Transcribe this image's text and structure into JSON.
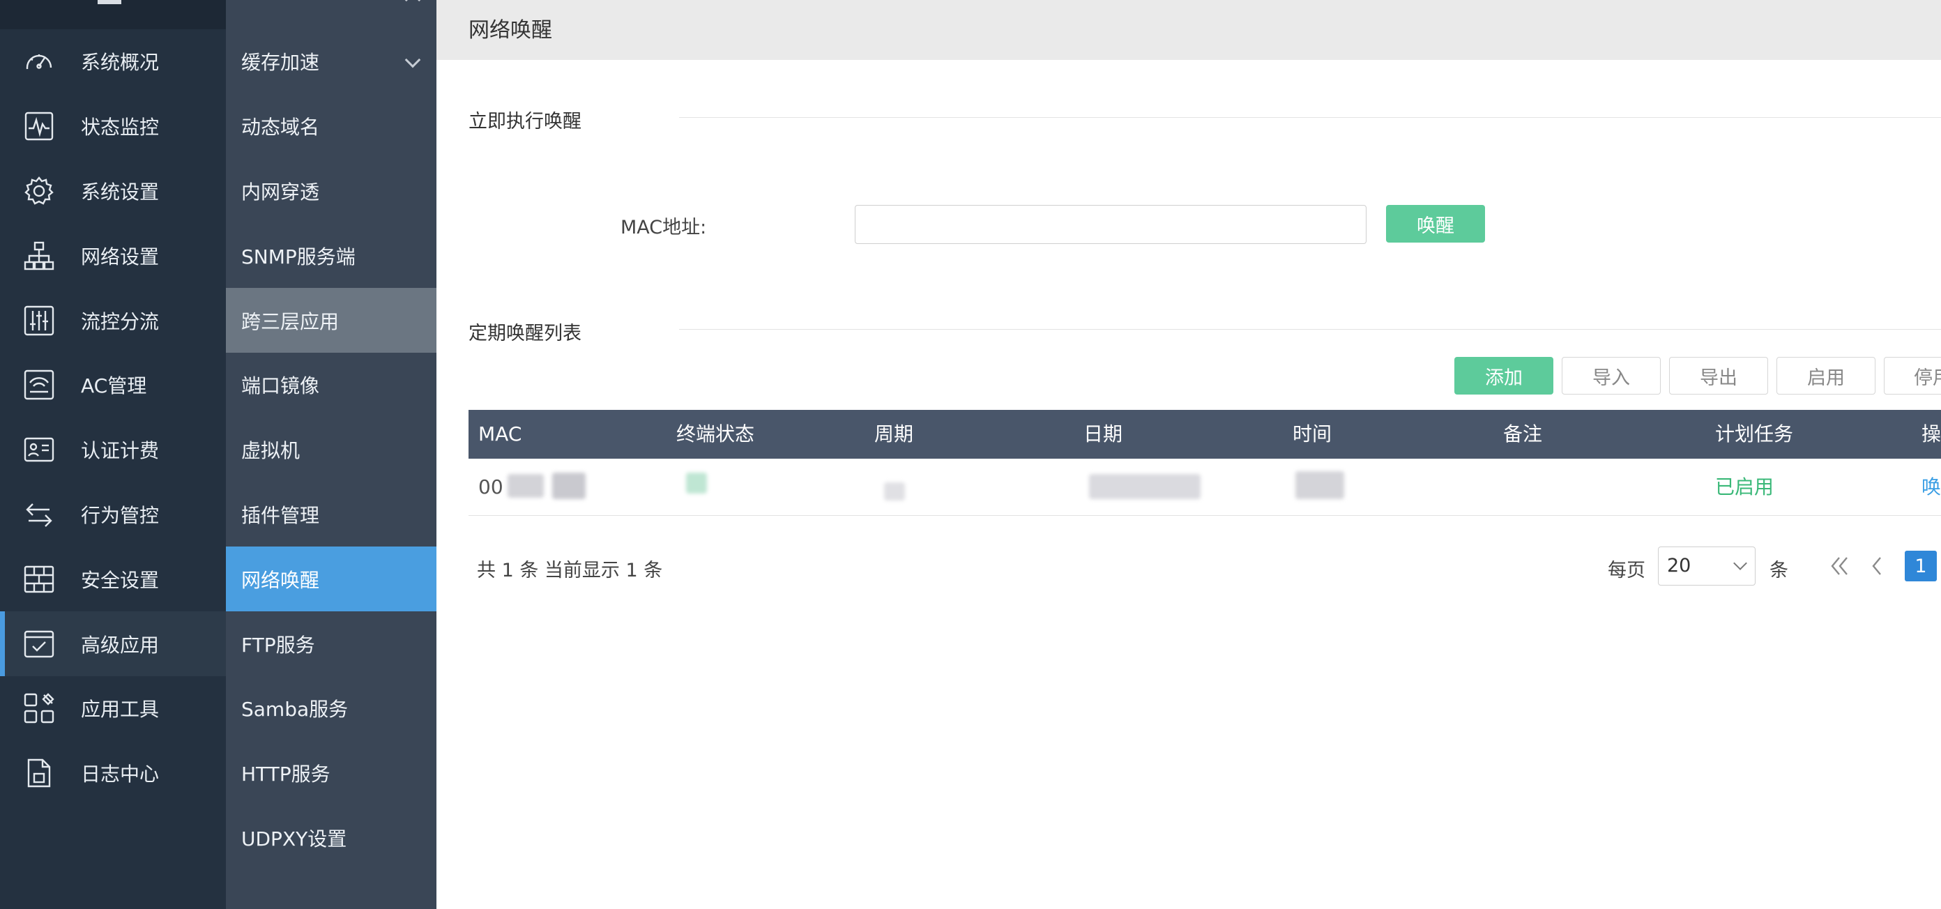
{
  "sidebar": {
    "items": [
      {
        "label": "系统概况",
        "icon": "dashboard-icon"
      },
      {
        "label": "状态监控",
        "icon": "pulse-monitor-icon"
      },
      {
        "label": "系统设置",
        "icon": "gear-icon"
      },
      {
        "label": "网络设置",
        "icon": "network-topology-icon"
      },
      {
        "label": "流控分流",
        "icon": "sliders-icon"
      },
      {
        "label": "AC管理",
        "icon": "wifi-router-icon"
      },
      {
        "label": "认证计费",
        "icon": "id-card-icon"
      },
      {
        "label": "行为管控",
        "icon": "arrows-exchange-icon"
      },
      {
        "label": "安全设置",
        "icon": "firewall-icon"
      },
      {
        "label": "高级应用",
        "icon": "checked-window-icon"
      },
      {
        "label": "应用工具",
        "icon": "app-grid-icon"
      },
      {
        "label": "日志中心",
        "icon": "log-document-icon"
      }
    ]
  },
  "subnav": {
    "items": [
      {
        "label": "缓存加速"
      },
      {
        "label": "动态域名"
      },
      {
        "label": "内网穿透"
      },
      {
        "label": "SNMP服务端"
      },
      {
        "label": "跨三层应用"
      },
      {
        "label": "端口镜像"
      },
      {
        "label": "虚拟机"
      },
      {
        "label": "插件管理"
      },
      {
        "label": "网络唤醒"
      },
      {
        "label": "FTP服务"
      },
      {
        "label": "Samba服务"
      },
      {
        "label": "HTTP服务"
      },
      {
        "label": "UDPXY设置"
      }
    ]
  },
  "page": {
    "title": "网络唤醒",
    "section_wake": "立即执行唤醒",
    "mac_label": "MAC地址:",
    "mac_value": "",
    "wake_button": "唤醒",
    "section_list": "定期唤醒列表",
    "toolbar": {
      "add": "添加",
      "import": "导入",
      "export": "导出",
      "enable": "启用",
      "disable": "停用"
    }
  },
  "table": {
    "columns": [
      "MAC",
      "终端状态",
      "周期",
      "日期",
      "时间",
      "备注",
      "计划任务",
      "操作"
    ],
    "rows": [
      {
        "mac_prefix": "00",
        "task": "已启用",
        "op": "唤醒"
      }
    ]
  },
  "pagination": {
    "summary": "共 1 条 当前显示 1 条",
    "per_page_label": "每页",
    "per_page_value": "20",
    "per_page_unit": "条",
    "current_page": "1"
  },
  "colors": {
    "sidebar_bg": "#243140",
    "subnav_bg": "#3a4656",
    "subnav_active": "#4a9ee0",
    "accent_green": "#5dcb9b",
    "table_header": "#49566a",
    "page_blue": "#2f87d8"
  }
}
